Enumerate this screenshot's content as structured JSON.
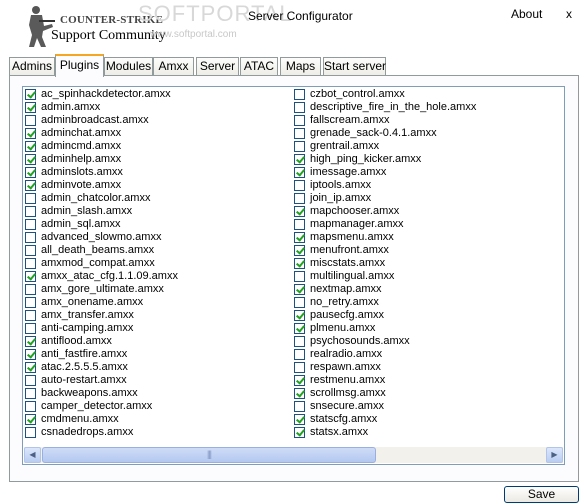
{
  "header": {
    "logo_line1": "COUNTER-STRIKE",
    "logo_line2": "Support Community",
    "watermark": "SOFTPORTAL",
    "watermark_url": "www.softportal.com",
    "title": "Server Configurator",
    "about_label": "About",
    "close_label": "x"
  },
  "tabs": [
    "Admins",
    "Plugins",
    "Modules",
    "Amxx",
    "Server",
    "ATAC",
    "Maps",
    "Start server"
  ],
  "active_tab": "Plugins",
  "plugins_left": [
    {
      "label": "ac_spinhackdetector.amxx",
      "checked": true
    },
    {
      "label": "admin.amxx",
      "checked": true
    },
    {
      "label": "adminbroadcast.amxx",
      "checked": false
    },
    {
      "label": "adminchat.amxx",
      "checked": true
    },
    {
      "label": "admincmd.amxx",
      "checked": true
    },
    {
      "label": "adminhelp.amxx",
      "checked": true
    },
    {
      "label": "adminslots.amxx",
      "checked": true
    },
    {
      "label": "adminvote.amxx",
      "checked": true
    },
    {
      "label": "admin_chatcolor.amxx",
      "checked": false
    },
    {
      "label": "admin_slash.amxx",
      "checked": false
    },
    {
      "label": "admin_sql.amxx",
      "checked": false
    },
    {
      "label": "advanced_slowmo.amxx",
      "checked": false
    },
    {
      "label": "all_death_beams.amxx",
      "checked": false
    },
    {
      "label": "amxmod_compat.amxx",
      "checked": false
    },
    {
      "label": "amxx_atac_cfg.1.1.09.amxx",
      "checked": true
    },
    {
      "label": "amx_gore_ultimate.amxx",
      "checked": false
    },
    {
      "label": "amx_onename.amxx",
      "checked": false
    },
    {
      "label": "amx_transfer.amxx",
      "checked": false
    },
    {
      "label": "anti-camping.amxx",
      "checked": false
    },
    {
      "label": "antiflood.amxx",
      "checked": true
    },
    {
      "label": "anti_fastfire.amxx",
      "checked": true
    },
    {
      "label": "atac.2.5.5.5.amxx",
      "checked": true
    },
    {
      "label": "auto-restart.amxx",
      "checked": false
    },
    {
      "label": "backweapons.amxx",
      "checked": false
    },
    {
      "label": "camper_detector.amxx",
      "checked": false
    },
    {
      "label": "cmdmenu.amxx",
      "checked": true
    },
    {
      "label": "csnadedrops.amxx",
      "checked": false
    }
  ],
  "plugins_right": [
    {
      "label": "czbot_control.amxx",
      "checked": false
    },
    {
      "label": "descriptive_fire_in_the_hole.amxx",
      "checked": false
    },
    {
      "label": "fallscream.amxx",
      "checked": false
    },
    {
      "label": "grenade_sack-0.4.1.amxx",
      "checked": false
    },
    {
      "label": "grentrail.amxx",
      "checked": false
    },
    {
      "label": "high_ping_kicker.amxx",
      "checked": true
    },
    {
      "label": "imessage.amxx",
      "checked": true
    },
    {
      "label": "iptools.amxx",
      "checked": false
    },
    {
      "label": "join_ip.amxx",
      "checked": false
    },
    {
      "label": "mapchooser.amxx",
      "checked": true
    },
    {
      "label": "mapmanager.amxx",
      "checked": false
    },
    {
      "label": "mapsmenu.amxx",
      "checked": true
    },
    {
      "label": "menufront.amxx",
      "checked": true
    },
    {
      "label": "miscstats.amxx",
      "checked": true
    },
    {
      "label": "multilingual.amxx",
      "checked": false
    },
    {
      "label": "nextmap.amxx",
      "checked": true
    },
    {
      "label": "no_retry.amxx",
      "checked": false
    },
    {
      "label": "pausecfg.amxx",
      "checked": true
    },
    {
      "label": "plmenu.amxx",
      "checked": true
    },
    {
      "label": "psychosounds.amxx",
      "checked": false
    },
    {
      "label": "realradio.amxx",
      "checked": false
    },
    {
      "label": "respawn.amxx",
      "checked": false
    },
    {
      "label": "restmenu.amxx",
      "checked": true
    },
    {
      "label": "scrollmsg.amxx",
      "checked": true
    },
    {
      "label": "snsecure.amxx",
      "checked": false
    },
    {
      "label": "statscfg.amxx",
      "checked": true
    },
    {
      "label": "statsx.amxx",
      "checked": true
    }
  ],
  "scrollbar": {
    "left_arrow": "◀",
    "right_arrow": "▶",
    "grip": "|||"
  },
  "save_label": "Save"
}
